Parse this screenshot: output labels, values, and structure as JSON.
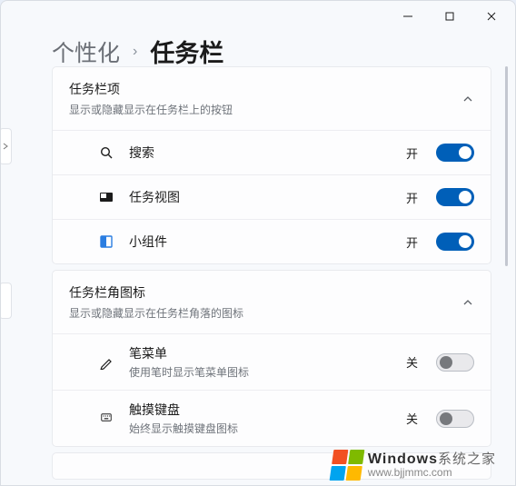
{
  "breadcrumb": {
    "parent": "个性化",
    "sep": "›",
    "current": "任务栏"
  },
  "sections": {
    "items": {
      "title": "任务栏项",
      "subtitle": "显示或隐藏显示在任务栏上的按钮",
      "rows": {
        "search": {
          "label": "搜索",
          "state": "开"
        },
        "taskview": {
          "label": "任务视图",
          "state": "开"
        },
        "widgets": {
          "label": "小组件",
          "state": "开"
        }
      }
    },
    "corner": {
      "title": "任务栏角图标",
      "subtitle": "显示或隐藏显示在任务栏角落的图标",
      "rows": {
        "pen": {
          "label": "笔菜单",
          "sub": "使用笔时显示笔菜单图标",
          "state": "关"
        },
        "touchkb": {
          "label": "触摸键盘",
          "sub": "始终显示触摸键盘图标",
          "state": "关"
        }
      }
    }
  },
  "watermark": {
    "brand1": "Windows",
    "brand2": "系统之家",
    "url": "www.bjjmmc.com"
  },
  "colors": {
    "accent": "#005fb8"
  }
}
